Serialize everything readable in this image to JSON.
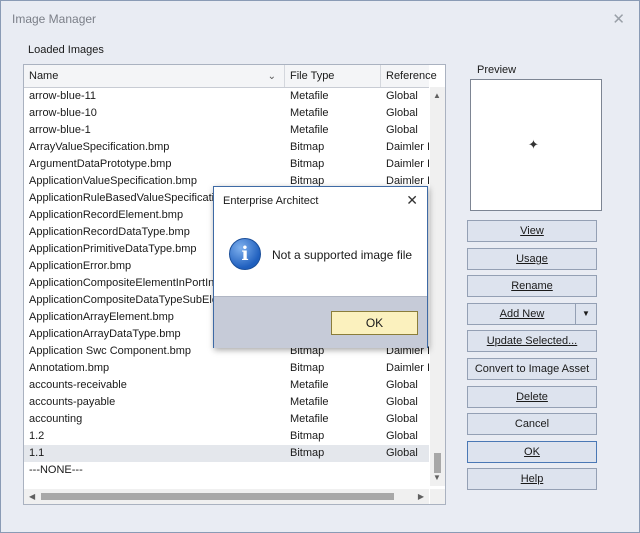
{
  "window": {
    "title": "Image Manager",
    "close_glyph": "✕"
  },
  "loaded_images_label": "Loaded Images",
  "preview_label": "Preview",
  "columns": {
    "name": "Name",
    "type": "File Type",
    "ref": "Reference"
  },
  "rows": [
    {
      "name": "arrow-blue-11",
      "type": "Metafile",
      "ref": "Global"
    },
    {
      "name": "arrow-blue-10",
      "type": "Metafile",
      "ref": "Global"
    },
    {
      "name": "arrow-blue-1",
      "type": "Metafile",
      "ref": "Global"
    },
    {
      "name": "ArrayValueSpecification.bmp",
      "type": "Bitmap",
      "ref": "Daimler I"
    },
    {
      "name": "ArgumentDataPrototype.bmp",
      "type": "Bitmap",
      "ref": "Daimler I"
    },
    {
      "name": "ApplicationValueSpecification.bmp",
      "type": "Bitmap",
      "ref": "Daimler I"
    },
    {
      "name": "ApplicationRuleBasedValueSpecification",
      "type": "",
      "ref": ""
    },
    {
      "name": "ApplicationRecordElement.bmp",
      "type": "",
      "ref": ""
    },
    {
      "name": "ApplicationRecordDataType.bmp",
      "type": "",
      "ref": ""
    },
    {
      "name": "ApplicationPrimitiveDataType.bmp",
      "type": "",
      "ref": ""
    },
    {
      "name": "ApplicationError.bmp",
      "type": "",
      "ref": ""
    },
    {
      "name": "ApplicationCompositeElementInPortInt",
      "type": "",
      "ref": ""
    },
    {
      "name": "ApplicationCompositeDataTypeSubElem",
      "type": "",
      "ref": ""
    },
    {
      "name": "ApplicationArrayElement.bmp",
      "type": "",
      "ref": ""
    },
    {
      "name": "ApplicationArrayDataType.bmp",
      "type": "",
      "ref": ""
    },
    {
      "name": "Application Swc Component.bmp",
      "type": "Bitmap",
      "ref": "Daimler I"
    },
    {
      "name": "Annotatiom.bmp",
      "type": "Bitmap",
      "ref": "Daimler I"
    },
    {
      "name": "accounts-receivable",
      "type": "Metafile",
      "ref": "Global"
    },
    {
      "name": "accounts-payable",
      "type": "Metafile",
      "ref": "Global"
    },
    {
      "name": "accounting",
      "type": "Metafile",
      "ref": "Global"
    },
    {
      "name": "1.2",
      "type": "Bitmap",
      "ref": "Global"
    },
    {
      "name": "1.1",
      "type": "Bitmap",
      "ref": "Global"
    },
    {
      "name": "---NONE---",
      "type": "",
      "ref": ""
    }
  ],
  "buttons": {
    "view": "View",
    "usage": "Usage",
    "rename": "Rename",
    "add_new": "Add New",
    "update_selected": "Update Selected...",
    "convert": "Convert to Image Asset",
    "delete": "Delete",
    "cancel": "Cancel",
    "ok": "OK",
    "help": "Help"
  },
  "dialog": {
    "title": "Enterprise Architect",
    "close_glyph": "✕",
    "icon_glyph": "i",
    "message": "Not a supported image file",
    "ok": "OK"
  },
  "icons": {
    "sort": "chevron-down-icon",
    "preview": "crosshair-icon",
    "info": "info-icon"
  },
  "colors": {
    "window_bg": "#e9ecf3",
    "button_bg": "#dde3ee",
    "dialog_footer": "#c6cbd8",
    "dialog_ok_bg": "#fbf1be",
    "info_blue": "#1f5fbe"
  }
}
